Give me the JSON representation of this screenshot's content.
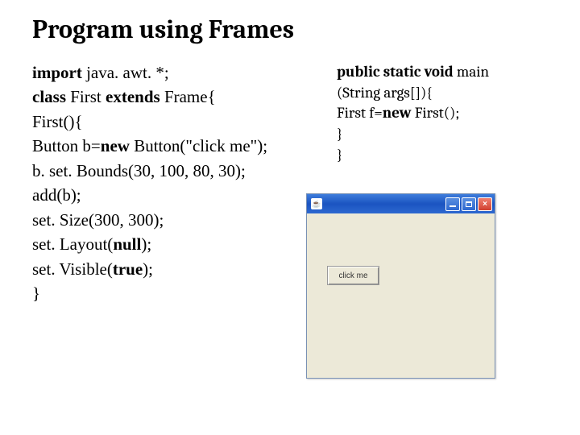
{
  "title": "Program using Frames",
  "left_code": [
    {
      "segments": [
        {
          "t": "import",
          "b": true
        },
        {
          "t": " java. awt. *;"
        }
      ]
    },
    {
      "segments": [
        {
          "t": "class ",
          "b": true
        },
        {
          "t": "First "
        },
        {
          "t": "extends ",
          "b": true
        },
        {
          "t": "Frame{"
        }
      ]
    },
    {
      "segments": [
        {
          "t": "First(){"
        }
      ]
    },
    {
      "segments": [
        {
          "t": "Button b="
        },
        {
          "t": "new ",
          "b": true
        },
        {
          "t": "Button(\"click me\");"
        }
      ]
    },
    {
      "segments": [
        {
          "t": "b. set. Bounds(30, 100, 80, 30);"
        }
      ]
    },
    {
      "segments": [
        {
          "t": "add(b);"
        }
      ]
    },
    {
      "segments": [
        {
          "t": "set. Size(300, 300);"
        }
      ]
    },
    {
      "segments": [
        {
          "t": "set. Layout("
        },
        {
          "t": "null",
          "b": true
        },
        {
          "t": ");"
        }
      ]
    },
    {
      "segments": [
        {
          "t": "set. Visible("
        },
        {
          "t": "true",
          "b": true
        },
        {
          "t": ");"
        }
      ]
    },
    {
      "segments": [
        {
          "t": "}"
        }
      ]
    }
  ],
  "right_code": [
    {
      "segments": [
        {
          "t": "public static void ",
          "b": true
        },
        {
          "t": "main"
        }
      ]
    },
    {
      "segments": [
        {
          "t": "(String args[]){"
        }
      ]
    },
    {
      "segments": [
        {
          "t": "First f="
        },
        {
          "t": "new ",
          "b": true
        },
        {
          "t": "First();"
        }
      ]
    },
    {
      "segments": [
        {
          "t": "}"
        }
      ]
    },
    {
      "segments": [
        {
          "t": "}"
        }
      ]
    }
  ],
  "frame": {
    "button_label": "click me"
  }
}
